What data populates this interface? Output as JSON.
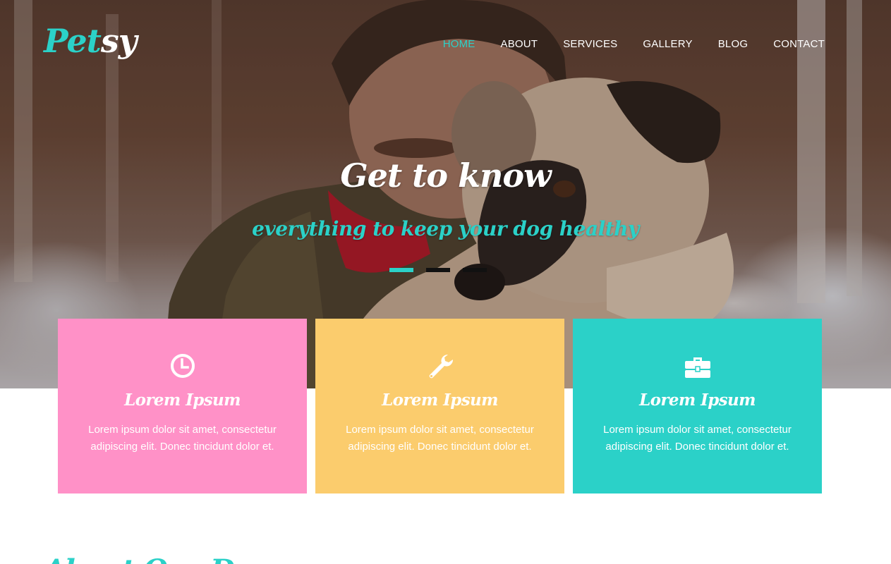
{
  "brand": {
    "logo_part1": "Pet",
    "logo_part2": "sy",
    "accent_color": "#2bd1c8"
  },
  "nav": {
    "items": [
      {
        "label": "HOME",
        "active": true
      },
      {
        "label": "ABOUT",
        "active": false
      },
      {
        "label": "SERVICES",
        "active": false
      },
      {
        "label": "GALLERY",
        "active": false
      },
      {
        "label": "BLOG",
        "active": false
      },
      {
        "label": "CONTACT",
        "active": false
      }
    ]
  },
  "hero": {
    "title": "Get to know",
    "subtitle": "everything to keep your dog healthy",
    "slides": 3,
    "active_slide": 1
  },
  "cards": [
    {
      "icon": "clock-icon",
      "title": "Lorem Ipsum",
      "text": "Lorem ipsum dolor sit amet, consectetur adipiscing elit. Donec tincidunt dolor et.",
      "color": "#ff91c7"
    },
    {
      "icon": "wrench-icon",
      "title": "Lorem Ipsum",
      "text": "Lorem ipsum dolor sit amet, consectetur adipiscing elit. Donec tincidunt dolor et.",
      "color": "#fbcc6d"
    },
    {
      "icon": "briefcase-icon",
      "title": "Lorem Ipsum",
      "text": "Lorem ipsum dolor sit amet, consectetur adipiscing elit. Donec tincidunt dolor et.",
      "color": "#2bd1c8"
    }
  ],
  "about": {
    "title": "About Our Dog"
  }
}
